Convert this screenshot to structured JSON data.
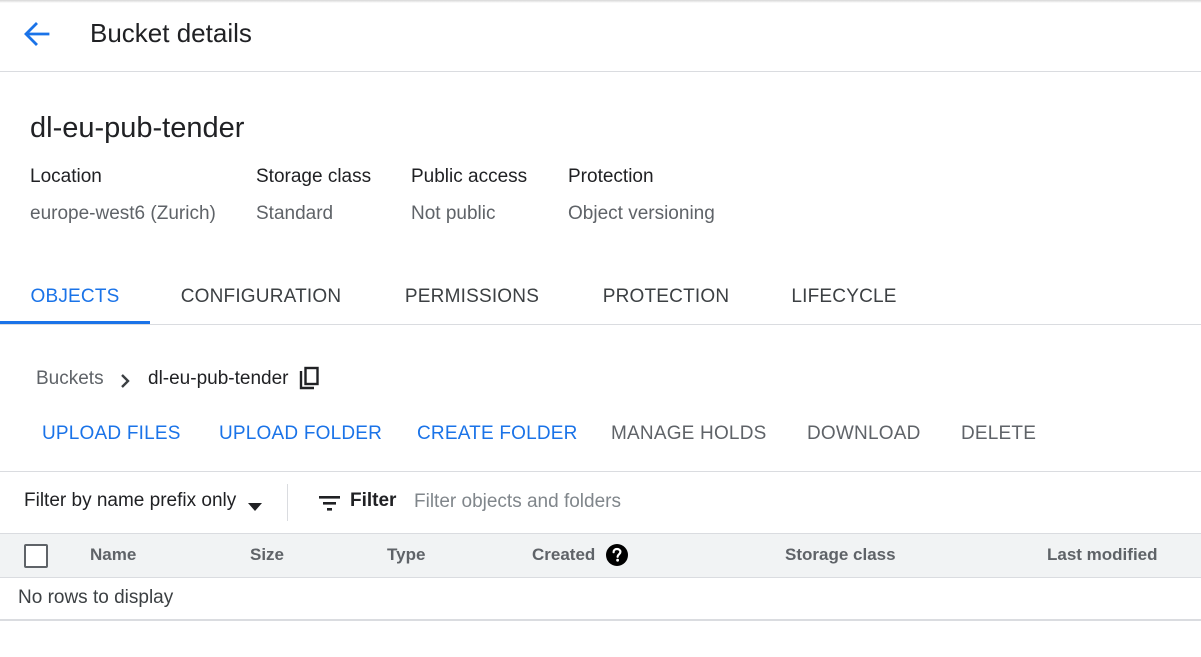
{
  "header": {
    "back_icon": "arrow-back-icon",
    "title": "Bucket details"
  },
  "bucket": {
    "name": "dl-eu-pub-tender",
    "meta": [
      {
        "label": "Location",
        "value": "europe-west6 (Zurich)"
      },
      {
        "label": "Storage class",
        "value": "Standard"
      },
      {
        "label": "Public access",
        "value": "Not public"
      },
      {
        "label": "Protection",
        "value": "Object versioning"
      }
    ]
  },
  "tabs": [
    {
      "label": "OBJECTS",
      "active": true
    },
    {
      "label": "CONFIGURATION",
      "active": false
    },
    {
      "label": "PERMISSIONS",
      "active": false
    },
    {
      "label": "PROTECTION",
      "active": false
    },
    {
      "label": "LIFECYCLE",
      "active": false
    }
  ],
  "breadcrumb": {
    "root": "Buckets",
    "separator_icon": "chevron-right-icon",
    "current": "dl-eu-pub-tender",
    "copy_icon": "copy-icon"
  },
  "actions": [
    {
      "label": "UPLOAD FILES",
      "enabled": true
    },
    {
      "label": "UPLOAD FOLDER",
      "enabled": true
    },
    {
      "label": "CREATE FOLDER",
      "enabled": true
    },
    {
      "label": "MANAGE HOLDS",
      "enabled": false
    },
    {
      "label": "DOWNLOAD",
      "enabled": false
    },
    {
      "label": "DELETE",
      "enabled": false
    }
  ],
  "filter": {
    "mode": "Filter by name prefix only",
    "mode_icon": "arrow-drop-down-icon",
    "filter_icon": "filter-list-icon",
    "label": "Filter",
    "placeholder": "Filter objects and folders",
    "value": ""
  },
  "table": {
    "columns": [
      "Name",
      "Size",
      "Type",
      "Created",
      "Storage class",
      "Last modified"
    ],
    "help_icon": "help-icon",
    "empty_text": "No rows to display",
    "rows": []
  },
  "colors": {
    "accent": "#1a73e8",
    "text_primary": "#202124",
    "text_secondary": "#5f6368",
    "divider": "#dadce0",
    "table_header_bg": "#f1f3f4"
  }
}
